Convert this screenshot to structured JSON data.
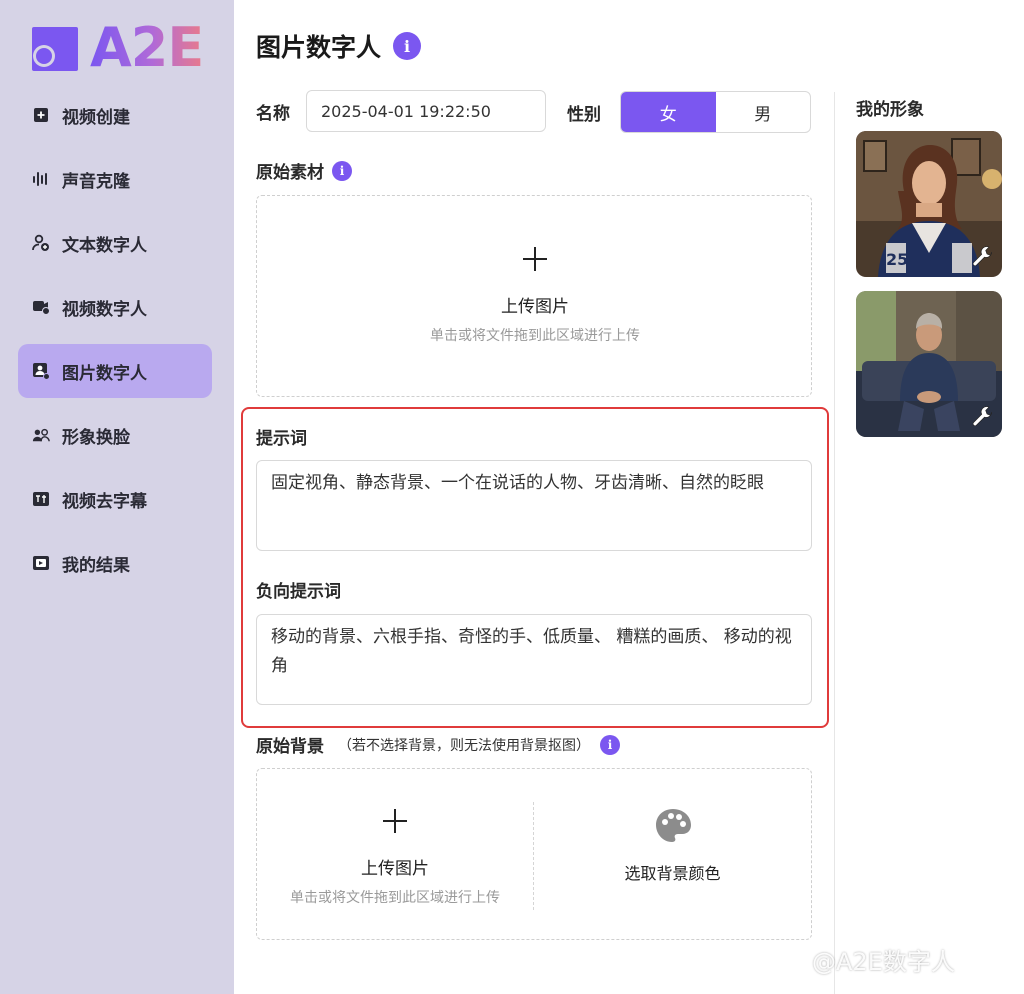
{
  "brand": {
    "logo_text": "A2E",
    "accent": "#7b57f0",
    "sidebar_bg": "#d6d3e6",
    "active_bg": "#b9a9ef",
    "highlight_border": "#e03b3b"
  },
  "sidebar": {
    "items": [
      {
        "label": "视频创建",
        "icon": "plus-square-icon"
      },
      {
        "label": "声音克隆",
        "icon": "waveform-icon"
      },
      {
        "label": "文本数字人",
        "icon": "user-text-icon"
      },
      {
        "label": "视频数字人",
        "icon": "video-user-icon"
      },
      {
        "label": "图片数字人",
        "icon": "image-user-icon",
        "active": true
      },
      {
        "label": "形象换脸",
        "icon": "face-swap-icon"
      },
      {
        "label": "视频去字幕",
        "icon": "subtitle-remove-icon"
      },
      {
        "label": "我的结果",
        "icon": "results-icon"
      }
    ]
  },
  "header": {
    "title": "图片数字人",
    "info_glyph": "i"
  },
  "form": {
    "name_label": "名称",
    "name_value": "2025-04-01 19:22:50",
    "gender_label": "性别",
    "gender_options": [
      "女",
      "男"
    ],
    "gender_selected": "女",
    "source_label": "原始素材",
    "upload_plus": "+",
    "upload_title": "上传图片",
    "upload_hint": "单击或将文件拖到此区域进行上传",
    "prompt_label": "提示词",
    "prompt_value": "固定视角、静态背景、一个在说话的人物、牙齿清晰、自然的眨眼",
    "negative_label": "负向提示词",
    "negative_value": "移动的背景、六根手指、奇怪的手、低质量、 糟糕的画质、 移动的视角",
    "background_label": "原始背景",
    "background_hint": "（若不选择背景，则无法使用背景抠图）",
    "bg_upload_title": "上传图片",
    "bg_upload_hint": "单击或将文件拖到此区域进行上传",
    "bg_color_label": "选取背景颜色"
  },
  "right_panel": {
    "title": "我的形象",
    "avatars": [
      {
        "name": "young woman in varsity jacket",
        "icon": "wrench-icon"
      },
      {
        "name": "older man seated on sofa",
        "icon": "wrench-icon"
      }
    ]
  },
  "watermark": "@A2E数字人"
}
